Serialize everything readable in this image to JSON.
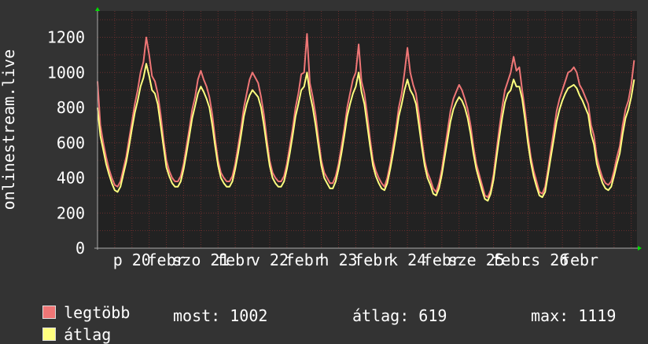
{
  "chart_data": {
    "type": "line",
    "ylabel": "onlinestream.live",
    "ylim": [
      0,
      1350
    ],
    "y_ticks": [
      0,
      200,
      400,
      600,
      800,
      1000,
      1200
    ],
    "x_tick_labels": [
      "p 20",
      "febr",
      "szo 21",
      "febr",
      "v 22",
      "febr",
      "h 23",
      "febr",
      "k 24",
      "febr",
      "sze 25",
      "febr",
      "cs 26",
      "febr"
    ],
    "grid": true,
    "colors": {
      "background": "#333333",
      "plot_background": "#222222",
      "grid": "#6a2e2e",
      "legtobb": "#ef7676",
      "atlag": "#ffff7f",
      "axis_arrow": "#00dd00"
    },
    "series": [
      {
        "name": "legtöbb",
        "x_hours": [
          0,
          1,
          2,
          3,
          4,
          5,
          6,
          7,
          8,
          9,
          10,
          11,
          12,
          13,
          14,
          15,
          16,
          17,
          18,
          19,
          20,
          21,
          22,
          23,
          24,
          25,
          26,
          27,
          28,
          29,
          30,
          31,
          32,
          33,
          34,
          35,
          36,
          37,
          38,
          39,
          40,
          41,
          42,
          43,
          44,
          45,
          46,
          47,
          48,
          49,
          50,
          51,
          52,
          53,
          54,
          55,
          56,
          57,
          58,
          59,
          60,
          61,
          62,
          63,
          64,
          65,
          66,
          67,
          68,
          69,
          70,
          71,
          72,
          73,
          74,
          75,
          76,
          77,
          78,
          79,
          80,
          81,
          82,
          83,
          84,
          85,
          86,
          87,
          88,
          89,
          90,
          91,
          92,
          93,
          94,
          95,
          96,
          97,
          98,
          99,
          100,
          101,
          102,
          103,
          104,
          105,
          106,
          107,
          108,
          109,
          110,
          111,
          112,
          113,
          114,
          115,
          116,
          117,
          118,
          119,
          120,
          121,
          122,
          123,
          124,
          125,
          126,
          127,
          128,
          129,
          130,
          131,
          132,
          133,
          134,
          135,
          136,
          137,
          138,
          139,
          140,
          141,
          142,
          143,
          144,
          145,
          146,
          147,
          148,
          149,
          150,
          151,
          152,
          153,
          154,
          155,
          156,
          157,
          158,
          159,
          160,
          161,
          162,
          163,
          164,
          165,
          166,
          167,
          168,
          169,
          170,
          171,
          172,
          173,
          174,
          175,
          176,
          177,
          178,
          179,
          180,
          181,
          182,
          183,
          184,
          185,
          186,
          187,
          188
        ],
        "values": [
          950,
          700,
          600,
          520,
          450,
          400,
          360,
          350,
          380,
          450,
          520,
          620,
          720,
          820,
          900,
          1000,
          1060,
          1200,
          1100,
          980,
          950,
          880,
          760,
          620,
          500,
          440,
          400,
          380,
          380,
          410,
          480,
          580,
          680,
          790,
          860,
          960,
          1010,
          960,
          920,
          860,
          760,
          620,
          500,
          430,
          400,
          380,
          380,
          410,
          480,
          580,
          680,
          800,
          880,
          960,
          1000,
          970,
          940,
          860,
          760,
          620,
          500,
          430,
          400,
          380,
          380,
          410,
          480,
          580,
          680,
          800,
          880,
          990,
          1000,
          1220,
          940,
          860,
          760,
          620,
          500,
          430,
          400,
          370,
          370,
          410,
          480,
          580,
          680,
          800,
          880,
          960,
          1000,
          1160,
          950,
          880,
          760,
          620,
          500,
          440,
          400,
          370,
          350,
          400,
          480,
          580,
          680,
          800,
          880,
          1000,
          1140,
          1000,
          930,
          880,
          760,
          620,
          500,
          430,
          390,
          340,
          320,
          370,
          450,
          560,
          670,
          780,
          850,
          890,
          930,
          900,
          850,
          790,
          700,
          580,
          480,
          420,
          360,
          300,
          290,
          330,
          420,
          550,
          680,
          800,
          900,
          950,
          1000,
          1090,
          1010,
          1030,
          900,
          780,
          640,
          520,
          440,
          380,
          320,
          310,
          350,
          450,
          560,
          670,
          780,
          850,
          900,
          950,
          1000,
          1010,
          1030,
          1000,
          930,
          900,
          860,
          820,
          700,
          640,
          520,
          450,
          400,
          370,
          360,
          380,
          440,
          520,
          580,
          700,
          790,
          840,
          930,
          1070
        ]
      },
      {
        "name": "átlag",
        "x_hours": [
          0,
          1,
          2,
          3,
          4,
          5,
          6,
          7,
          8,
          9,
          10,
          11,
          12,
          13,
          14,
          15,
          16,
          17,
          18,
          19,
          20,
          21,
          22,
          23,
          24,
          25,
          26,
          27,
          28,
          29,
          30,
          31,
          32,
          33,
          34,
          35,
          36,
          37,
          38,
          39,
          40,
          41,
          42,
          43,
          44,
          45,
          46,
          47,
          48,
          49,
          50,
          51,
          52,
          53,
          54,
          55,
          56,
          57,
          58,
          59,
          60,
          61,
          62,
          63,
          64,
          65,
          66,
          67,
          68,
          69,
          70,
          71,
          72,
          73,
          74,
          75,
          76,
          77,
          78,
          79,
          80,
          81,
          82,
          83,
          84,
          85,
          86,
          87,
          88,
          89,
          90,
          91,
          92,
          93,
          94,
          95,
          96,
          97,
          98,
          99,
          100,
          101,
          102,
          103,
          104,
          105,
          106,
          107,
          108,
          109,
          110,
          111,
          112,
          113,
          114,
          115,
          116,
          117,
          118,
          119,
          120,
          121,
          122,
          123,
          124,
          125,
          126,
          127,
          128,
          129,
          130,
          131,
          132,
          133,
          134,
          135,
          136,
          137,
          138,
          139,
          140,
          141,
          142,
          143,
          144,
          145,
          146,
          147,
          148,
          149,
          150,
          151,
          152,
          153,
          154,
          155,
          156,
          157,
          158,
          159,
          160,
          161,
          162,
          163,
          164,
          165,
          166,
          167,
          168,
          169,
          170,
          171,
          172,
          173,
          174,
          175,
          176,
          177,
          178,
          179,
          180,
          181,
          182,
          183,
          184,
          185,
          186,
          187,
          188
        ],
        "values": [
          800,
          640,
          560,
          480,
          420,
          370,
          330,
          320,
          350,
          420,
          490,
          580,
          680,
          770,
          840,
          920,
          970,
          1050,
          980,
          900,
          880,
          820,
          700,
          580,
          460,
          410,
          370,
          350,
          350,
          380,
          450,
          540,
          640,
          740,
          810,
          880,
          920,
          890,
          850,
          800,
          700,
          580,
          470,
          400,
          370,
          350,
          350,
          380,
          450,
          540,
          640,
          750,
          820,
          870,
          900,
          880,
          860,
          800,
          700,
          580,
          470,
          400,
          370,
          350,
          350,
          380,
          450,
          540,
          640,
          750,
          820,
          900,
          920,
          1000,
          880,
          800,
          700,
          580,
          470,
          400,
          370,
          340,
          340,
          380,
          450,
          540,
          640,
          750,
          820,
          880,
          920,
          1000,
          890,
          820,
          700,
          580,
          470,
          410,
          370,
          340,
          330,
          370,
          450,
          540,
          640,
          750,
          820,
          900,
          960,
          900,
          870,
          820,
          700,
          580,
          470,
          400,
          360,
          310,
          300,
          340,
          420,
          520,
          620,
          720,
          790,
          830,
          860,
          840,
          800,
          740,
          650,
          540,
          450,
          390,
          330,
          280,
          270,
          310,
          390,
          510,
          630,
          740,
          830,
          880,
          900,
          960,
          920,
          920,
          850,
          730,
          600,
          490,
          410,
          350,
          300,
          290,
          320,
          420,
          520,
          620,
          720,
          790,
          840,
          880,
          910,
          920,
          930,
          910,
          870,
          840,
          800,
          760,
          650,
          590,
          480,
          420,
          370,
          340,
          330,
          350,
          410,
          480,
          540,
          650,
          740,
          790,
          860,
          960
        ]
      }
    ]
  },
  "legend": [
    {
      "label": "legtöbb",
      "color": "#ef7676"
    },
    {
      "label": "átlag",
      "color": "#ffff7f"
    }
  ],
  "stats": {
    "most": "most: 1002",
    "atlag": "átlag: 619",
    "max": "max: 1119"
  }
}
